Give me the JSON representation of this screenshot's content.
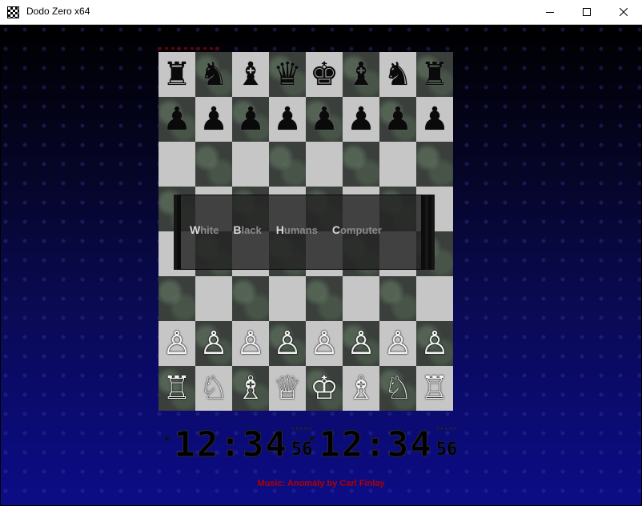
{
  "window": {
    "title": "Dodo Zero x64",
    "controls": [
      "minimize-icon",
      "maximize-icon",
      "close-icon"
    ]
  },
  "board": {
    "rows": [
      [
        "♜",
        "♞",
        "♝",
        "♛",
        "♚",
        "♝",
        "♞",
        "♜"
      ],
      [
        "♟",
        "♟",
        "♟",
        "♟",
        "♟",
        "♟",
        "♟",
        "♟"
      ],
      [
        "",
        "",
        "",
        "",
        "",
        "",
        "",
        ""
      ],
      [
        "",
        "",
        "",
        "",
        "",
        "",
        "",
        ""
      ],
      [
        "",
        "",
        "",
        "",
        "",
        "",
        "",
        ""
      ],
      [
        "",
        "",
        "",
        "",
        "",
        "",
        "",
        ""
      ],
      [
        "♙",
        "♙",
        "♙",
        "♙",
        "♙",
        "♙",
        "♙",
        "♙"
      ],
      [
        "♖",
        "♘",
        "♗",
        "♕",
        "♔",
        "♗",
        "♘",
        "♖"
      ]
    ]
  },
  "menu": {
    "items": [
      {
        "key": "W",
        "rest": "hite"
      },
      {
        "key": "B",
        "rest": "lack"
      },
      {
        "key": "H",
        "rest": "umans"
      },
      {
        "key": "C",
        "rest": "omputer"
      }
    ]
  },
  "clocks": {
    "white": {
      "hm": "12:34",
      "sec": "56"
    },
    "black": {
      "hm": "12:34",
      "sec": "56"
    }
  },
  "credit": "Music: Anomaly by Carl Finlay",
  "colors": {
    "credit": "#b00000",
    "light_square": "#c6c6c6",
    "dark_square": "#3a3f3b",
    "background_bottom": "#0c0c86"
  }
}
